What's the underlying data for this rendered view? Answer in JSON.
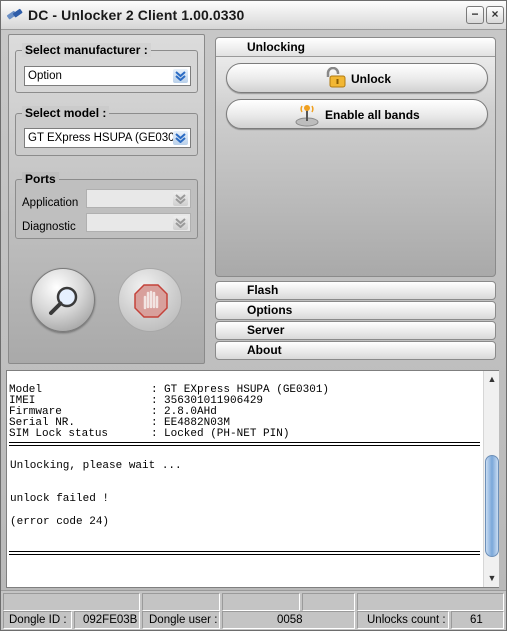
{
  "window": {
    "title": "DC - Unlocker 2 Client 1.00.0330",
    "minimize_label": "−",
    "close_label": "×"
  },
  "manufacturer": {
    "label": "Select manufacturer :",
    "value": "Option"
  },
  "model": {
    "label": "Select model :",
    "value": "GT EXpress HSUPA (GE0301)"
  },
  "ports": {
    "label": "Ports",
    "application_label": "Application",
    "diagnostic_label": "Diagnostic",
    "application_value": "",
    "diagnostic_value": ""
  },
  "unlocking": {
    "header": "Unlocking",
    "unlock_label": "Unlock",
    "bands_label": "Enable all bands"
  },
  "tabs": [
    "Flash",
    "Options",
    "Server",
    "About"
  ],
  "device_info": [
    {
      "key": "Model",
      "value": "GT EXpress HSUPA (GE0301)"
    },
    {
      "key": "IMEI",
      "value": "356301011906429"
    },
    {
      "key": "Firmware",
      "value": "2.8.0AHd"
    },
    {
      "key": "Serial NR.",
      "value": "EE4882N03M"
    },
    {
      "key": "SIM Lock status",
      "value": "Locked (PH-NET PIN)"
    }
  ],
  "log_lines": [
    "Unlocking, please wait ...",
    "unlock failed !",
    "(error code 24)"
  ],
  "status": {
    "dongle_id_label": "Dongle ID :",
    "dongle_id_value": "092FE03B",
    "dongle_user_label": "Dongle user :",
    "dongle_user_value": "0058",
    "unlocks_label": "Unlocks count :",
    "unlocks_value": "61"
  },
  "colors": {
    "accent_blue": "#4f8fd6",
    "stop_red": "#c4423a"
  }
}
